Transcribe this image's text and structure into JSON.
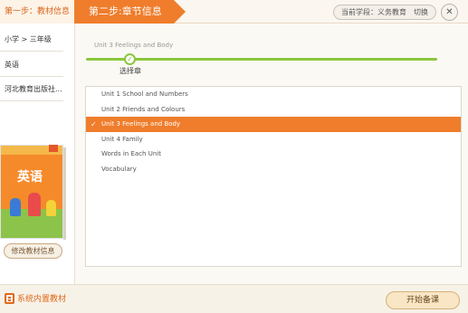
{
  "header": {
    "step1": "第一步：教材信息",
    "step2": "第二步:章节信息",
    "stage_label": "当前学段：义务教育",
    "switch_label": "切换",
    "close_icon": "✕"
  },
  "sidebar": {
    "items": [
      {
        "label": "小学 > 三年级"
      },
      {
        "label": "英语"
      },
      {
        "label": "河北教育出版社..."
      }
    ],
    "book_title": "英语",
    "modify_label": "修改教材信息"
  },
  "main": {
    "breadcrumb": "Unit 3 Feelings and Body",
    "progress_step_label": "选择章",
    "chapters": [
      {
        "label": "Unit 1 School and Numbers",
        "selected": false
      },
      {
        "label": "Unit 2 Friends and Colours",
        "selected": false
      },
      {
        "label": "Unit 3 Feelings and Body",
        "selected": true
      },
      {
        "label": "Unit 4 Family",
        "selected": false
      },
      {
        "label": "Words in Each Unit",
        "selected": false
      },
      {
        "label": "Vocabulary",
        "selected": false
      }
    ],
    "selected_tick": "✓"
  },
  "footer": {
    "system_label": "系统内置教材",
    "start_label": "开始备课"
  },
  "colors": {
    "accent": "#ef7d2c",
    "progress": "#8cc63f"
  }
}
